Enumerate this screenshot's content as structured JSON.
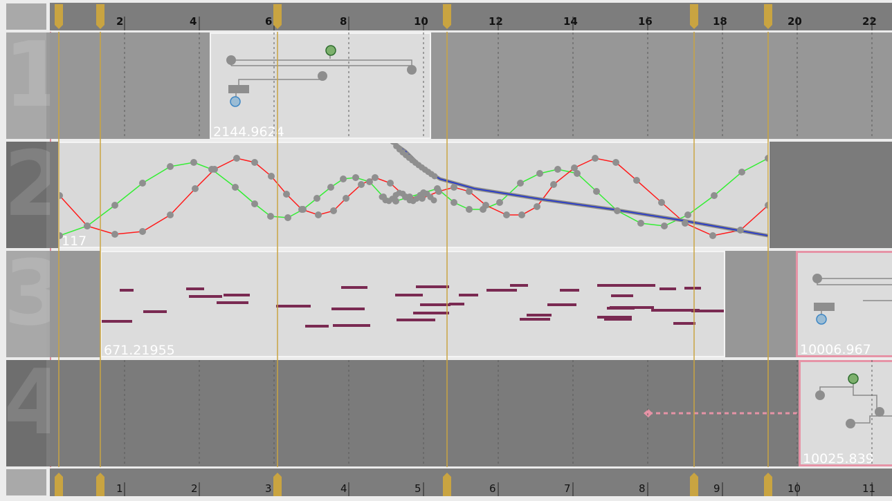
{
  "top_ruler": {
    "labels": [
      "2",
      "4",
      "6",
      "8",
      "10",
      "12",
      "14",
      "16",
      "18",
      "20",
      "22"
    ]
  },
  "bottom_ruler": {
    "labels": [
      "1",
      "2",
      "3",
      "4",
      "5",
      "6",
      "7",
      "8",
      "9",
      "10",
      "11"
    ]
  },
  "tracks": [
    {
      "number": "1",
      "block_label": "2144.9624"
    },
    {
      "number": "2",
      "block_label": "117"
    },
    {
      "number": "3",
      "block_label": "671.21955",
      "side_block_label": "10006.967"
    },
    {
      "number": "4",
      "block_label": "10025.839"
    }
  ],
  "colors": {
    "accent_selection": "#e693a6",
    "marker": "#c9a441",
    "curve_red": "#ff1a1a",
    "curve_green": "#33ee33",
    "curve_blue": "#1a2fd6",
    "note": "#7a2a52"
  }
}
